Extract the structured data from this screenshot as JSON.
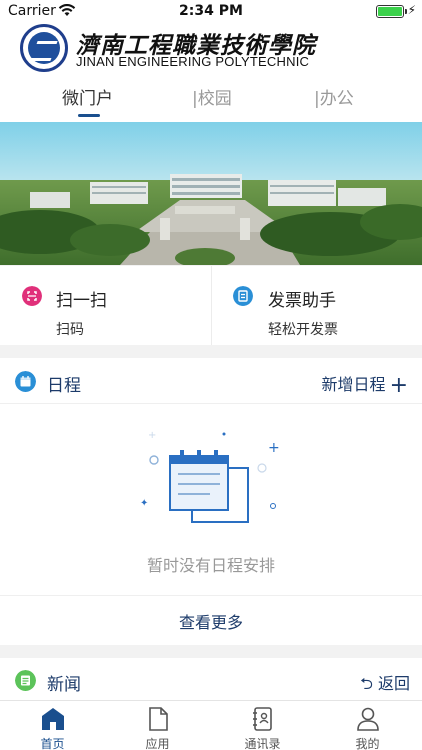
{
  "status_bar": {
    "carrier": "Carrier",
    "time": "2:34 PM",
    "battery_level": 1.0
  },
  "header": {
    "school_name_cn": "濟南工程職業技術學院",
    "school_name_en": "JINAN ENGINEERING POLYTECHNIC"
  },
  "tabs": [
    {
      "label": "微门户",
      "active": true
    },
    {
      "label": "|校园",
      "active": false
    },
    {
      "label": "|办公",
      "active": false
    }
  ],
  "quick_actions": [
    {
      "title": "扫一扫",
      "subtitle": "扫码",
      "icon": "scan-icon",
      "color": "#e0307a"
    },
    {
      "title": "发票助手",
      "subtitle": "轻松开发票",
      "icon": "invoice-icon",
      "color": "#2a8fd6"
    }
  ],
  "schedule": {
    "title": "日程",
    "add_label": "新增日程",
    "empty_text": "暂时没有日程安排",
    "more_label": "查看更多",
    "icon": "calendar-icon",
    "icon_color": "#2a8fd6"
  },
  "news": {
    "title": "新闻",
    "back_label": "返回",
    "icon": "news-icon",
    "icon_color": "#5cc35a"
  },
  "tab_bar": [
    {
      "label": "首页",
      "icon": "home-icon",
      "active": true
    },
    {
      "label": "应用",
      "icon": "document-icon",
      "active": false
    },
    {
      "label": "通讯录",
      "icon": "contacts-icon",
      "active": false
    },
    {
      "label": "我的",
      "icon": "profile-icon",
      "active": false
    }
  ],
  "colors": {
    "accent": "#1a4f8e",
    "link": "#1d3b6a",
    "muted": "#999999"
  }
}
